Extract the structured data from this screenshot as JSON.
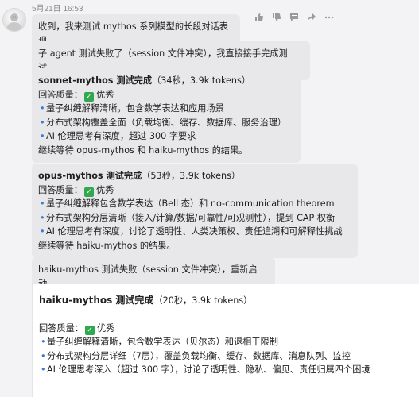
{
  "timestamp": "5月21日 16:53",
  "messages": {
    "m1": "收到，我来测试 mythos 系列模型的长段对话表现。",
    "m2": "子 agent 测试失败了（session 文件冲突），我直接接手完成测试。",
    "sonnet": {
      "title": "sonnet-mythos 测试完成",
      "meta": "（34秒，3.9k tokens）",
      "quality_label": "回答质量：",
      "quality_value": "优秀",
      "items": [
        "量子纠缠解释清晰，包含数学表达和应用场景",
        "分布式架构覆盖全面（负载均衡、缓存、数据库、服务治理）",
        "AI 伦理思考有深度，超过 300 字要求"
      ],
      "footer": "继续等待 opus-mythos 和 haiku-mythos 的结果。"
    },
    "opus": {
      "title": "opus-mythos 测试完成",
      "meta": "（53秒，3.9k tokens）",
      "quality_label": "回答质量：",
      "quality_value": "优秀",
      "items": [
        "量子纠缠解释包含数学表达（Bell 态）和 no-communication theorem",
        "分布式架构分层清晰（接入/计算/数据/可靠性/可观测性），提到 CAP 权衡",
        "AI 伦理思考有深度，讨论了透明性、人类决策权、责任追溯和可解释性挑战"
      ],
      "footer": "继续等待 haiku-mythos 的结果。"
    },
    "m5": "haiku-mythos 测试失败（session 文件冲突），重新启动。",
    "haiku": {
      "title": "haiku-mythos 测试完成",
      "meta": "（20秒，3.9k tokens）",
      "quality_label": "回答质量：",
      "quality_value": "优秀",
      "items": [
        "量子纠缠解释清晰，包含数学表达（贝尔态）和退相干限制",
        "分布式架构分层详细（7层），覆盖负载均衡、缓存、数据库、消息队列、监控",
        "AI 伦理思考深入（超过 300 字），讨论了透明性、隐私、偏见、责任归属四个困境"
      ]
    }
  },
  "icons": {
    "check": "✓",
    "bullet": "•"
  }
}
